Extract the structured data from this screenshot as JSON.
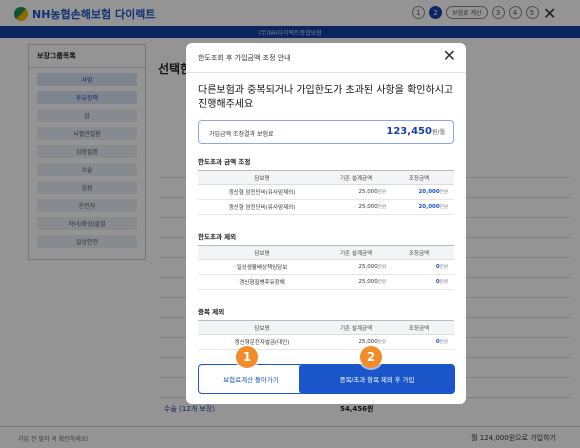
{
  "header": {
    "brand": "NH농협손해보험 다이렉트",
    "steps": [
      "1",
      "2",
      "보험료 계산",
      "3",
      "4",
      "5"
    ],
    "close_icon": "close-icon"
  },
  "subbar": {
    "title": "(무)NH다이렉트종합보험"
  },
  "sidebar": {
    "title": "보장그룹목록",
    "items": [
      "사망",
      "후유장해",
      "암",
      "뇌혈관질환",
      "심장질환",
      "수술",
      "입원",
      "운전자",
      "자녀/화상/골절",
      "일상안전"
    ]
  },
  "content": {
    "title": "선택한",
    "total_label": "수술",
    "total_count": "(12개 보장)",
    "total_value": "54,456원"
  },
  "bottom": {
    "note": "가입 전 필히 꼭 확인하세요!",
    "total": "월 124,000원으로 가입하기"
  },
  "modal": {
    "title": "한도조회 후 가입금액 조정 안내",
    "headline": "다른보험과 중복되거나 가입한도가 초과된 사항을 확인하시고 진행해주세요",
    "adjusted_label": "가입금액 조정결과 보험료",
    "adjusted_value": "123,450",
    "adjusted_unit": "원/월",
    "columns": [
      "담보명",
      "기존 설계금액",
      "조정금액"
    ],
    "sections": [
      {
        "title": "한도초과 금액 조정",
        "rows": [
          {
            "name": "갱신형 암진단비(유사암제외)",
            "before": "25,000",
            "after": "20,000",
            "unit": "만원"
          },
          {
            "name": "갱신형 암진단비(유사암제외)",
            "before": "25,000",
            "after": "20,000",
            "unit": "만원"
          }
        ]
      },
      {
        "title": "한도초과 제외",
        "rows": [
          {
            "name": "일상생활배상책임담보",
            "before": "25,000",
            "after": "0",
            "unit": "만원"
          },
          {
            "name": "갱신형질병후유장해",
            "before": "25,000",
            "after": "0",
            "unit": "만원"
          }
        ]
      },
      {
        "title": "중복 제외",
        "rows": [
          {
            "name": "갱신형운전자벌금(대인)",
            "before": "25,000",
            "after": "0",
            "unit": "만원"
          }
        ]
      }
    ],
    "back_button": "보험료계산 돌아가기",
    "confirm_button": "중복/초과 항목 제외 후 가입",
    "markers": [
      "1",
      "2"
    ]
  }
}
